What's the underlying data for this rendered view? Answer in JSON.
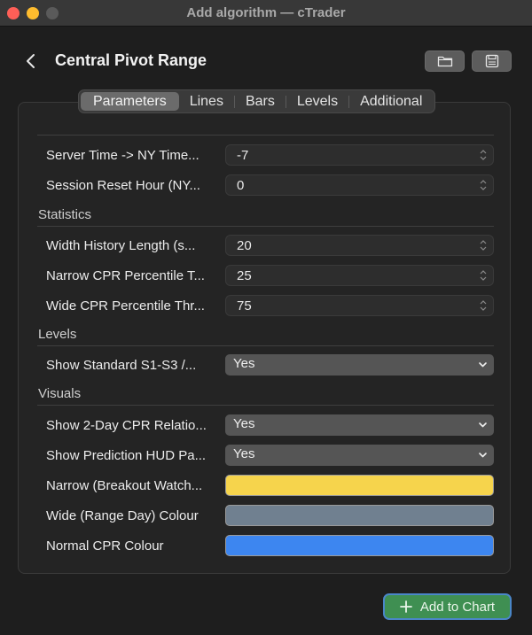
{
  "window": {
    "title": "Add algorithm — cTrader"
  },
  "header": {
    "title": "Central Pivot Range",
    "icons": {
      "back": "chevron-left-icon",
      "folder": "folder-icon",
      "save": "save-icon"
    }
  },
  "tabs": [
    {
      "label": "Parameters",
      "active": true
    },
    {
      "label": "Lines"
    },
    {
      "label": "Bars"
    },
    {
      "label": "Levels"
    },
    {
      "label": "Additional"
    }
  ],
  "params": {
    "server_time": {
      "label": "Server Time -> NY Time...",
      "value": "-7"
    },
    "session_reset": {
      "label": "Session Reset Hour (NY...",
      "value": "0"
    }
  },
  "statistics": {
    "title": "Statistics",
    "width_history": {
      "label": "Width History Length (s...",
      "value": "20"
    },
    "narrow_pct": {
      "label": "Narrow CPR Percentile T...",
      "value": "25"
    },
    "wide_pct": {
      "label": "Wide CPR Percentile Thr...",
      "value": "75"
    }
  },
  "levels": {
    "title": "Levels",
    "show_standard": {
      "label": "Show Standard S1-S3 /...",
      "value": "Yes"
    }
  },
  "visuals": {
    "title": "Visuals",
    "show_2day": {
      "label": "Show 2-Day CPR Relatio...",
      "value": "Yes"
    },
    "show_hud": {
      "label": "Show Prediction HUD Pa...",
      "value": "Yes"
    },
    "narrow_colour": {
      "label": "Narrow (Breakout Watch...",
      "color": "#f6d44c"
    },
    "wide_colour": {
      "label": "Wide (Range Day) Colour",
      "color": "#708090"
    },
    "normal_colour": {
      "label": "Normal CPR Colour",
      "color": "#3d86f0"
    }
  },
  "footer": {
    "add_button": "Add to Chart",
    "add_icon": "plus-icon"
  },
  "colors": {
    "accent_green": "#3f8f52",
    "focus_ring": "#4a86c8"
  }
}
